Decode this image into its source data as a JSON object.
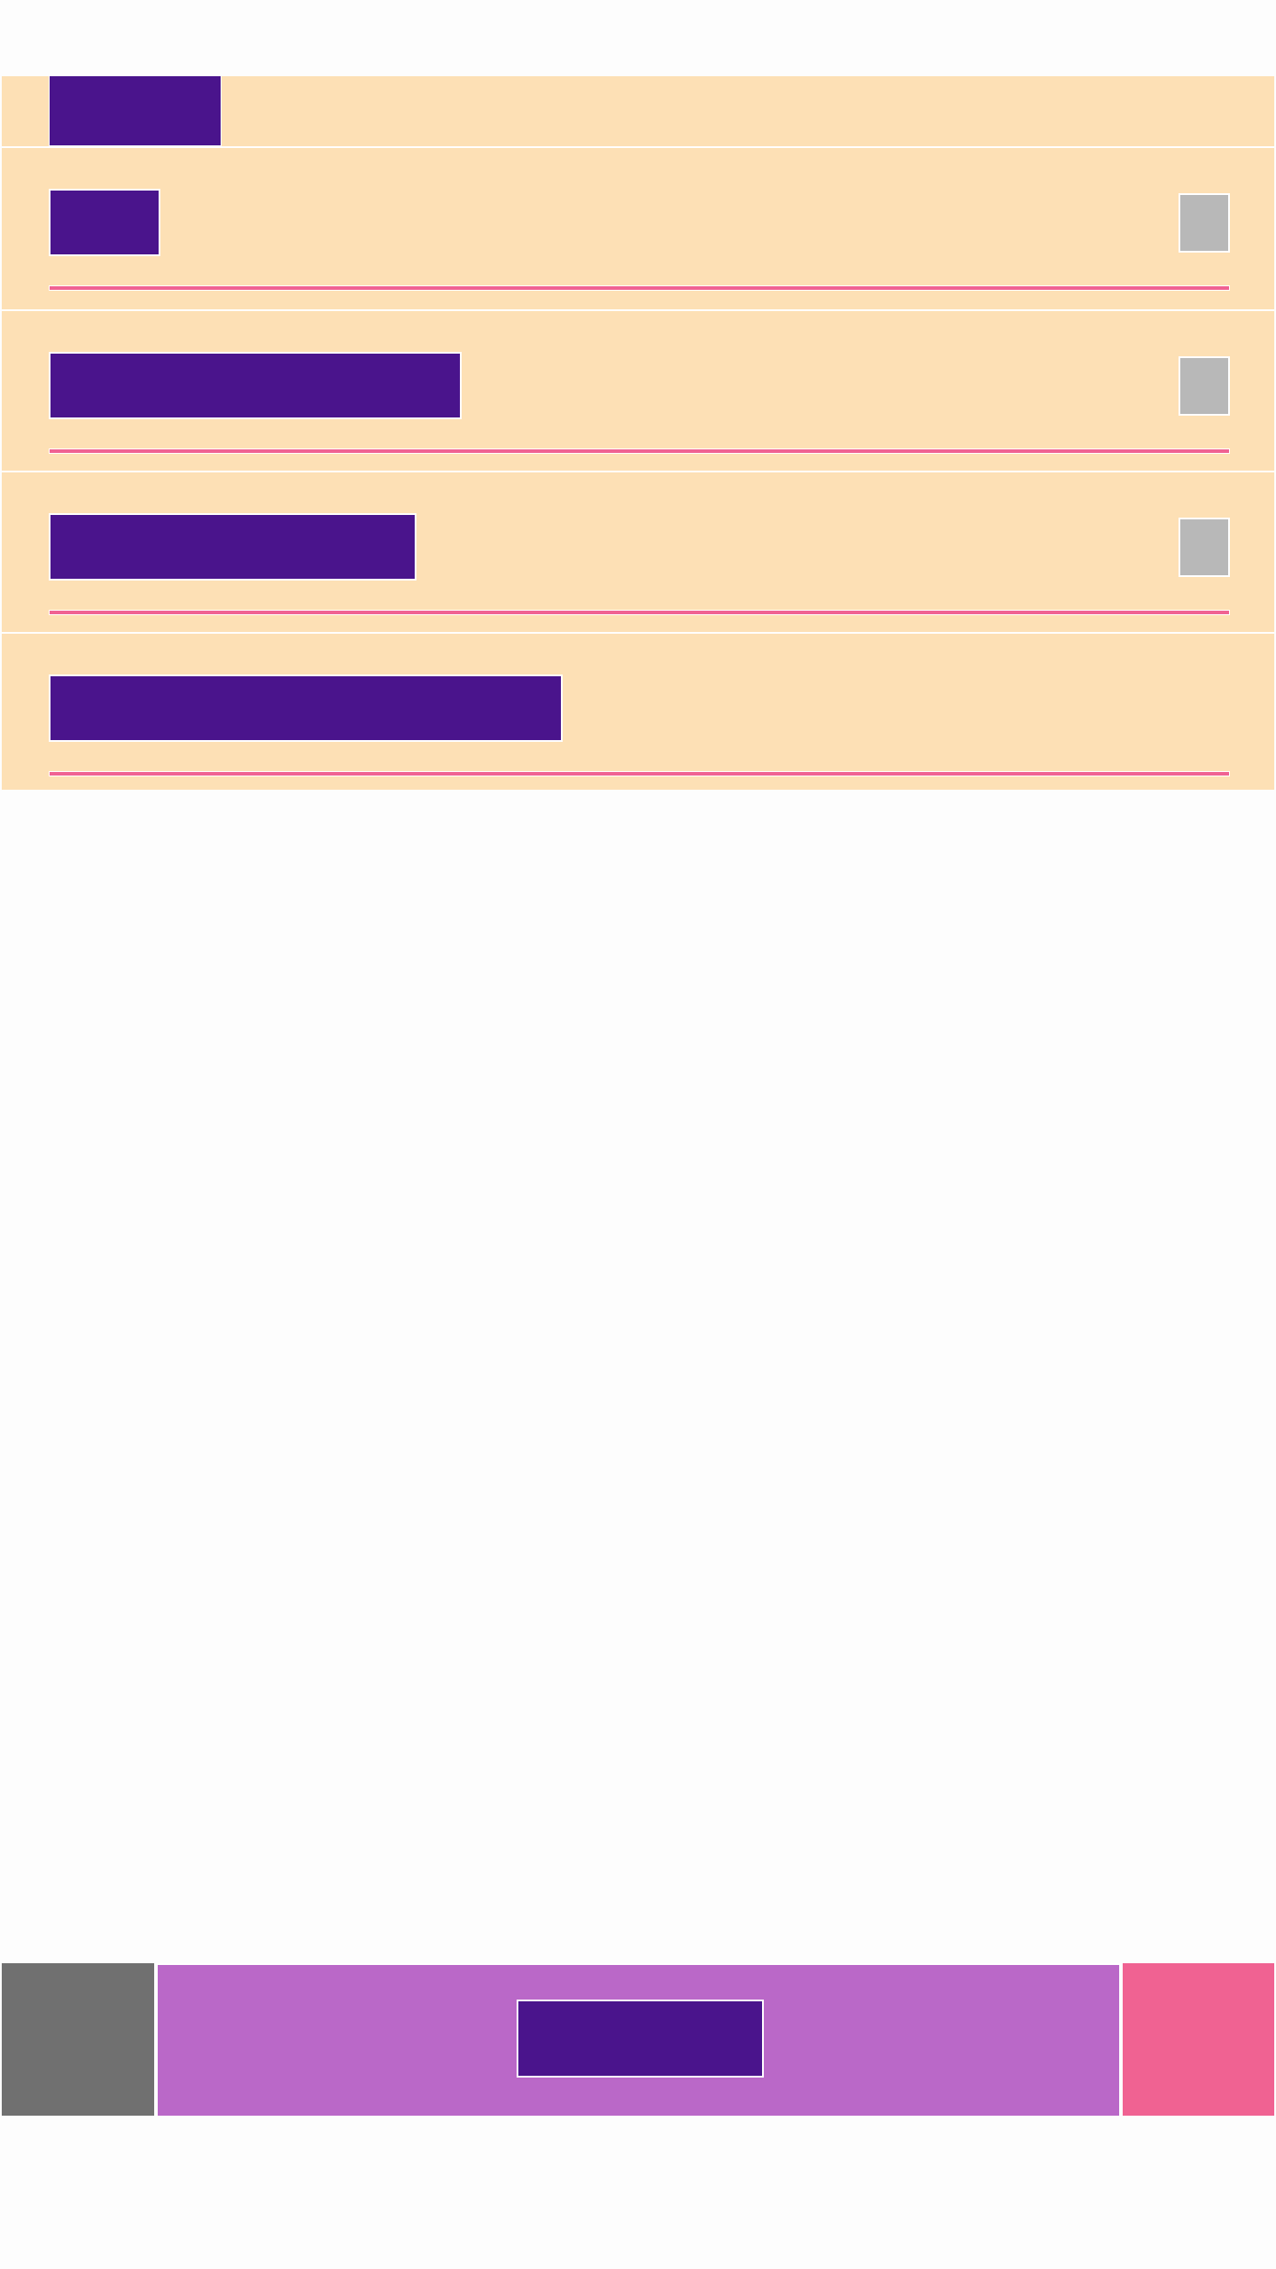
{
  "colors": {
    "page_background": "#fdfdfd",
    "panel_background": "#fde0b5",
    "label_fill": "#4a148c",
    "toggle_fill": "#b8b8b8",
    "rule_color": "#f06292",
    "bottom_left_fill": "#707070",
    "bottom_middle_fill": "#ba68c8",
    "bottom_right_fill": "#f06292",
    "divider_color": "#ffffff"
  },
  "header": {
    "title": ""
  },
  "list": {
    "rows": [
      {
        "label": "",
        "has_toggle": true
      },
      {
        "label": "",
        "has_toggle": true
      },
      {
        "label": "",
        "has_toggle": true
      },
      {
        "label": "",
        "has_toggle": false
      }
    ]
  },
  "bottom_bar": {
    "left_label": "",
    "center_button_label": "",
    "right_label": ""
  }
}
